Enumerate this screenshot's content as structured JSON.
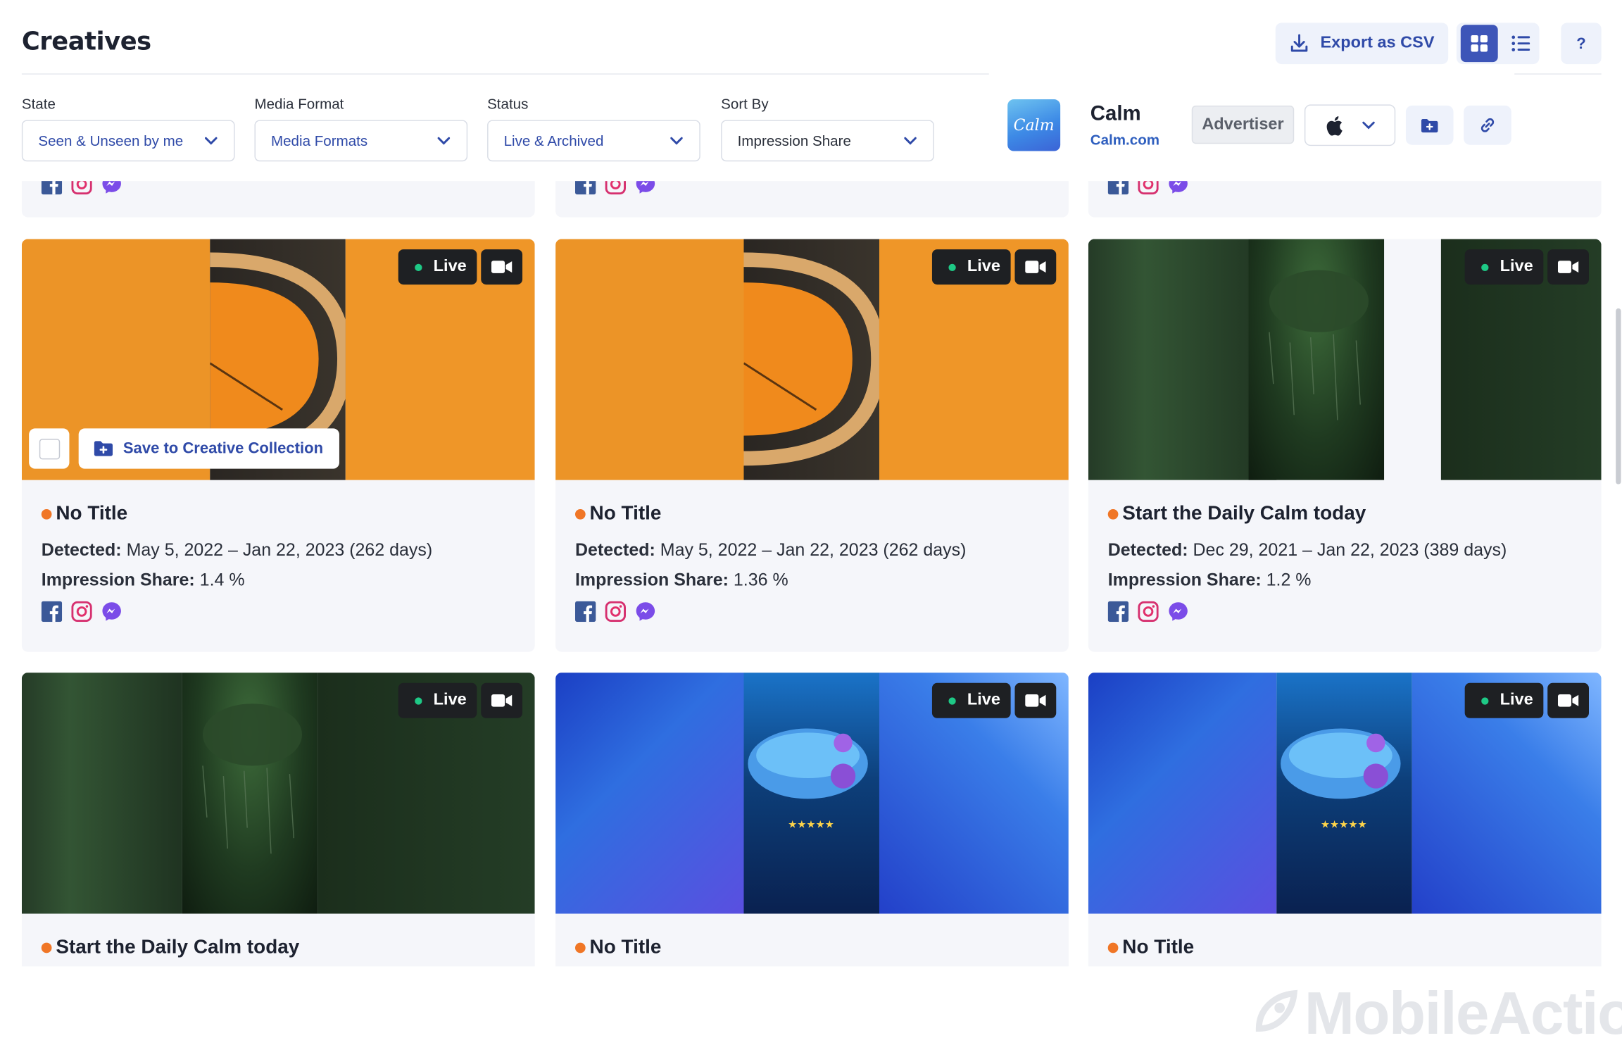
{
  "page": {
    "title": "Creatives"
  },
  "toolbar": {
    "export_label": "Export as CSV",
    "help_label": "?"
  },
  "filters": [
    {
      "label": "State",
      "value": "Seen & Unseen by me"
    },
    {
      "label": "Media Format",
      "value": "Media Formats"
    },
    {
      "label": "Status",
      "value": "Live & Archived"
    },
    {
      "label": "Sort By",
      "value": "Impression Share"
    }
  ],
  "advertiser": {
    "logo_text": "Calm",
    "name": "Calm",
    "domain": "Calm.com",
    "badge": "Advertiser",
    "platform": "apple-icon"
  },
  "card_labels": {
    "detected": "Detected:",
    "impression": "Impression Share:",
    "live": "Live",
    "save": "Save to Creative Collection"
  },
  "cards": [
    {
      "title": "No Title",
      "detected": "May 5, 2022 – Jan 22, 2023 (262 days)",
      "impression_share": "1.4 %",
      "theme": "orange"
    },
    {
      "title": "No Title",
      "detected": "May 5, 2022 – Jan 22, 2023 (262 days)",
      "impression_share": "1.36 %",
      "theme": "orange"
    },
    {
      "title": "Start the Daily Calm today",
      "detected": "Dec 29, 2021 – Jan 22, 2023 (389 days)",
      "impression_share": "1.2 %",
      "theme": "green"
    },
    {
      "title": "Start the Daily Calm today",
      "theme": "green"
    },
    {
      "title": "No Title",
      "theme": "blue"
    },
    {
      "title": "No Title",
      "theme": "blue"
    }
  ],
  "watermark": "MobileAction",
  "colors": {
    "accent": "#2f4aa8",
    "live": "#1ec986",
    "status_dot": "#f07626"
  }
}
